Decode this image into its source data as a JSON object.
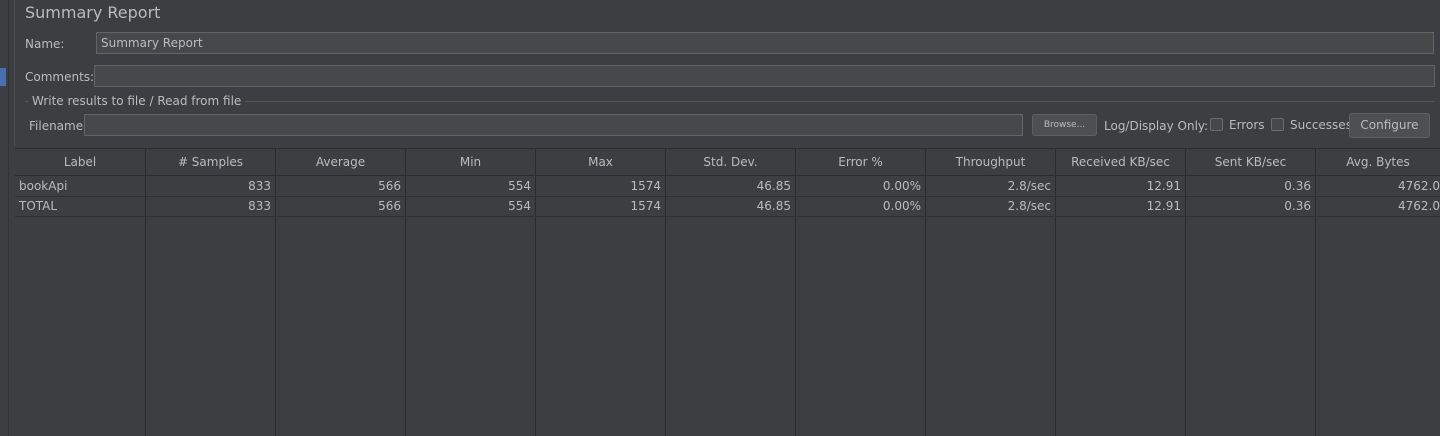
{
  "title": "Summary Report",
  "name": {
    "label": "Name:",
    "value": "Summary Report"
  },
  "comments": {
    "label": "Comments:",
    "value": ""
  },
  "file_section": {
    "title": "Write results to file / Read from file",
    "filename_label": "Filename",
    "filename_value": "",
    "browse_label": "Browse...",
    "log_display_label": "Log/Display Only:",
    "errors_label": "Errors",
    "errors_checked": false,
    "successes_label": "Successes",
    "successes_checked": false,
    "configure_label": "Configure"
  },
  "table": {
    "columns": [
      "Label",
      "# Samples",
      "Average",
      "Min",
      "Max",
      "Std. Dev.",
      "Error %",
      "Throughput",
      "Received KB/sec",
      "Sent KB/sec",
      "Avg. Bytes"
    ],
    "rows": [
      [
        "bookApi",
        "833",
        "566",
        "554",
        "1574",
        "46.85",
        "0.00%",
        "2.8/sec",
        "12.91",
        "0.36",
        "4762.0"
      ],
      [
        "TOTAL",
        "833",
        "566",
        "554",
        "1574",
        "46.85",
        "0.00%",
        "2.8/sec",
        "12.91",
        "0.36",
        "4762.0"
      ]
    ]
  }
}
